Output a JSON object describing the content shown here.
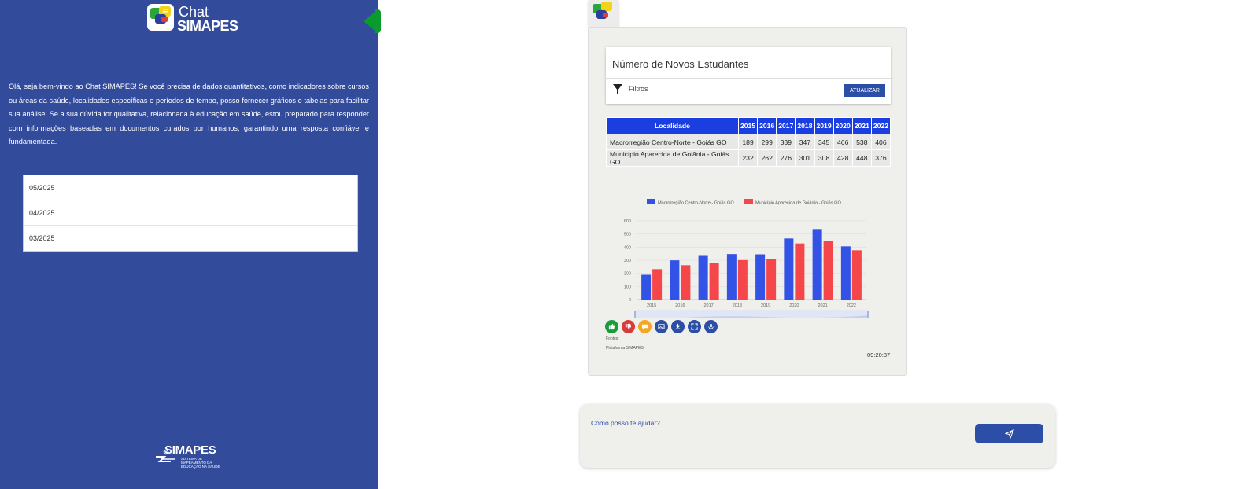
{
  "sidebar": {
    "logo": {
      "line1": "Chat",
      "line2": "SIMAPES"
    },
    "intro": "Olá, seja bem-vindo ao Chat SIMAPES! Se você precisa de dados quantitativos, como indicadores sobre cursos ou áreas da saúde, localidades específicas e períodos de tempo, posso fornecer gráficos e tabelas para facilitar sua análise. Se a sua dúvida for qualitativa, relacionada à educação em saúde, estou preparado para responder com informações baseadas em documentos curados por humanos, garantindo uma resposta confiável e fundamentada.",
    "history": [
      "05/2025",
      "04/2025",
      "03/2025"
    ],
    "footer_logo": {
      "name": "SIMAPES",
      "subtitle": "SISTEMA DE MAPEAMENTO DA EDUCAÇÃO NA SAÚDE"
    }
  },
  "card": {
    "title": "Número de Novos Estudantes",
    "filter_label": "Filtros",
    "update_button": "ATUALIZAR",
    "table": {
      "header": [
        "Localidade",
        "2015",
        "2016",
        "2017",
        "2018",
        "2019",
        "2020",
        "2021",
        "2022"
      ],
      "rows": [
        [
          "Macrorregião Centro-Norte - Goiás GO",
          "189",
          "299",
          "339",
          "347",
          "345",
          "466",
          "538",
          "406"
        ],
        [
          "Município Aparecida de Goiânia - Goiás GO",
          "232",
          "262",
          "276",
          "301",
          "308",
          "428",
          "448",
          "376"
        ]
      ]
    },
    "sources_label": "Fontes:",
    "platform_label": "Plataforma SIMAPES",
    "timestamp": "09:20:37",
    "actions": [
      {
        "icon": "thumbs-up-icon",
        "color": "#1a9b3c"
      },
      {
        "icon": "thumbs-down-icon",
        "color": "#d93a3a"
      },
      {
        "icon": "comment-icon",
        "color": "#f5a623"
      },
      {
        "icon": "image-icon",
        "color": "#2d4ea6"
      },
      {
        "icon": "download-icon",
        "color": "#2d4ea6"
      },
      {
        "icon": "fullscreen-icon",
        "color": "#2d4ea6"
      },
      {
        "icon": "microphone-icon",
        "color": "#2d4ea6"
      }
    ]
  },
  "chart_data": {
    "type": "bar",
    "categories": [
      "2015",
      "2016",
      "2017",
      "2018",
      "2019",
      "2020",
      "2021",
      "2022"
    ],
    "series": [
      {
        "name": "Macrorregião Centro-Norte - Goiás GO",
        "color": "#3352e6",
        "values": [
          189,
          299,
          339,
          347,
          345,
          466,
          538,
          406
        ]
      },
      {
        "name": "Município Aparecida de Goiânia - Goiás GO",
        "color": "#f5464a",
        "values": [
          232,
          262,
          276,
          301,
          308,
          428,
          448,
          376
        ]
      }
    ],
    "y_ticks": [
      "0",
      "100",
      "200",
      "300",
      "400",
      "500",
      "600"
    ],
    "ylim": [
      0,
      600
    ],
    "legend_position": "top-center",
    "grid": true
  },
  "composer": {
    "placeholder": "Como posso te ajudar?"
  }
}
